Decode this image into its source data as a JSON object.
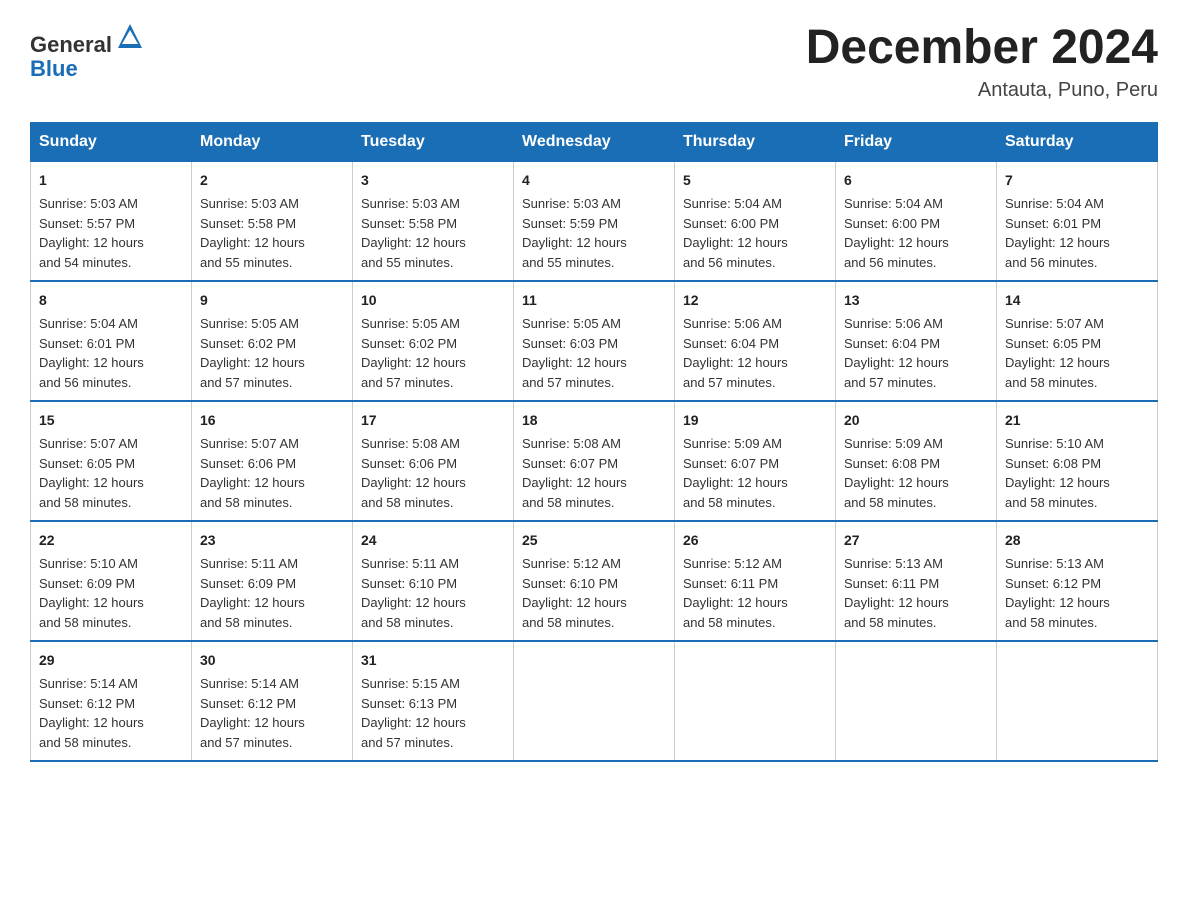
{
  "header": {
    "logo_text_general": "General",
    "logo_text_blue": "Blue",
    "title": "December 2024",
    "subtitle": "Antauta, Puno, Peru"
  },
  "days_of_week": [
    "Sunday",
    "Monday",
    "Tuesday",
    "Wednesday",
    "Thursday",
    "Friday",
    "Saturday"
  ],
  "weeks": [
    [
      {
        "day": "1",
        "sunrise": "5:03 AM",
        "sunset": "5:57 PM",
        "daylight": "12 hours and 54 minutes."
      },
      {
        "day": "2",
        "sunrise": "5:03 AM",
        "sunset": "5:58 PM",
        "daylight": "12 hours and 55 minutes."
      },
      {
        "day": "3",
        "sunrise": "5:03 AM",
        "sunset": "5:58 PM",
        "daylight": "12 hours and 55 minutes."
      },
      {
        "day": "4",
        "sunrise": "5:03 AM",
        "sunset": "5:59 PM",
        "daylight": "12 hours and 55 minutes."
      },
      {
        "day": "5",
        "sunrise": "5:04 AM",
        "sunset": "6:00 PM",
        "daylight": "12 hours and 56 minutes."
      },
      {
        "day": "6",
        "sunrise": "5:04 AM",
        "sunset": "6:00 PM",
        "daylight": "12 hours and 56 minutes."
      },
      {
        "day": "7",
        "sunrise": "5:04 AM",
        "sunset": "6:01 PM",
        "daylight": "12 hours and 56 minutes."
      }
    ],
    [
      {
        "day": "8",
        "sunrise": "5:04 AM",
        "sunset": "6:01 PM",
        "daylight": "12 hours and 56 minutes."
      },
      {
        "day": "9",
        "sunrise": "5:05 AM",
        "sunset": "6:02 PM",
        "daylight": "12 hours and 57 minutes."
      },
      {
        "day": "10",
        "sunrise": "5:05 AM",
        "sunset": "6:02 PM",
        "daylight": "12 hours and 57 minutes."
      },
      {
        "day": "11",
        "sunrise": "5:05 AM",
        "sunset": "6:03 PM",
        "daylight": "12 hours and 57 minutes."
      },
      {
        "day": "12",
        "sunrise": "5:06 AM",
        "sunset": "6:04 PM",
        "daylight": "12 hours and 57 minutes."
      },
      {
        "day": "13",
        "sunrise": "5:06 AM",
        "sunset": "6:04 PM",
        "daylight": "12 hours and 57 minutes."
      },
      {
        "day": "14",
        "sunrise": "5:07 AM",
        "sunset": "6:05 PM",
        "daylight": "12 hours and 58 minutes."
      }
    ],
    [
      {
        "day": "15",
        "sunrise": "5:07 AM",
        "sunset": "6:05 PM",
        "daylight": "12 hours and 58 minutes."
      },
      {
        "day": "16",
        "sunrise": "5:07 AM",
        "sunset": "6:06 PM",
        "daylight": "12 hours and 58 minutes."
      },
      {
        "day": "17",
        "sunrise": "5:08 AM",
        "sunset": "6:06 PM",
        "daylight": "12 hours and 58 minutes."
      },
      {
        "day": "18",
        "sunrise": "5:08 AM",
        "sunset": "6:07 PM",
        "daylight": "12 hours and 58 minutes."
      },
      {
        "day": "19",
        "sunrise": "5:09 AM",
        "sunset": "6:07 PM",
        "daylight": "12 hours and 58 minutes."
      },
      {
        "day": "20",
        "sunrise": "5:09 AM",
        "sunset": "6:08 PM",
        "daylight": "12 hours and 58 minutes."
      },
      {
        "day": "21",
        "sunrise": "5:10 AM",
        "sunset": "6:08 PM",
        "daylight": "12 hours and 58 minutes."
      }
    ],
    [
      {
        "day": "22",
        "sunrise": "5:10 AM",
        "sunset": "6:09 PM",
        "daylight": "12 hours and 58 minutes."
      },
      {
        "day": "23",
        "sunrise": "5:11 AM",
        "sunset": "6:09 PM",
        "daylight": "12 hours and 58 minutes."
      },
      {
        "day": "24",
        "sunrise": "5:11 AM",
        "sunset": "6:10 PM",
        "daylight": "12 hours and 58 minutes."
      },
      {
        "day": "25",
        "sunrise": "5:12 AM",
        "sunset": "6:10 PM",
        "daylight": "12 hours and 58 minutes."
      },
      {
        "day": "26",
        "sunrise": "5:12 AM",
        "sunset": "6:11 PM",
        "daylight": "12 hours and 58 minutes."
      },
      {
        "day": "27",
        "sunrise": "5:13 AM",
        "sunset": "6:11 PM",
        "daylight": "12 hours and 58 minutes."
      },
      {
        "day": "28",
        "sunrise": "5:13 AM",
        "sunset": "6:12 PM",
        "daylight": "12 hours and 58 minutes."
      }
    ],
    [
      {
        "day": "29",
        "sunrise": "5:14 AM",
        "sunset": "6:12 PM",
        "daylight": "12 hours and 58 minutes."
      },
      {
        "day": "30",
        "sunrise": "5:14 AM",
        "sunset": "6:12 PM",
        "daylight": "12 hours and 57 minutes."
      },
      {
        "day": "31",
        "sunrise": "5:15 AM",
        "sunset": "6:13 PM",
        "daylight": "12 hours and 57 minutes."
      },
      null,
      null,
      null,
      null
    ]
  ],
  "labels": {
    "sunrise": "Sunrise:",
    "sunset": "Sunset:",
    "daylight": "Daylight:"
  }
}
